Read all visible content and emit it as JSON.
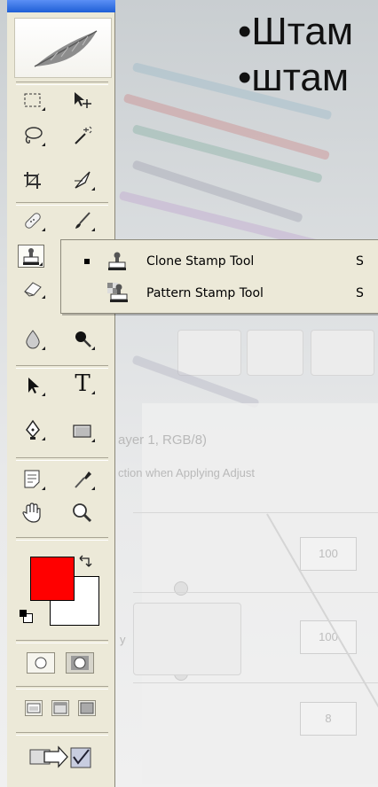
{
  "slide": {
    "bullets": [
      "•Штам",
      "•штам"
    ]
  },
  "toolbox": {
    "tools": [
      "rectangular-marquee-icon",
      "move-icon",
      "lasso-icon",
      "magic-wand-icon",
      "crop-icon",
      "slice-icon",
      "healing-brush-icon",
      "brush-icon",
      "clone-stamp-icon",
      "history-brush-icon",
      "eraser-icon",
      "gradient-icon",
      "blur-icon",
      "dodge-icon",
      "path-selection-icon",
      "type-icon",
      "pen-icon",
      "shape-icon",
      "notes-icon",
      "eyedropper-icon",
      "hand-icon",
      "zoom-icon"
    ],
    "type_tool_glyph": "T",
    "foreground_color": "#ff0000",
    "background_color": "#ffffff"
  },
  "flyout": {
    "items": [
      {
        "label": "Clone Stamp Tool",
        "shortcut": "S",
        "selected": true
      },
      {
        "label": "Pattern Stamp Tool",
        "shortcut": "S",
        "selected": false
      }
    ]
  },
  "background": {
    "layer_text": "ayer 1, RGB/8)",
    "adjust_text": "ction when Applying Adjust",
    "opacity_label": "y",
    "field1": "100",
    "field2": "100",
    "field3": "8"
  }
}
